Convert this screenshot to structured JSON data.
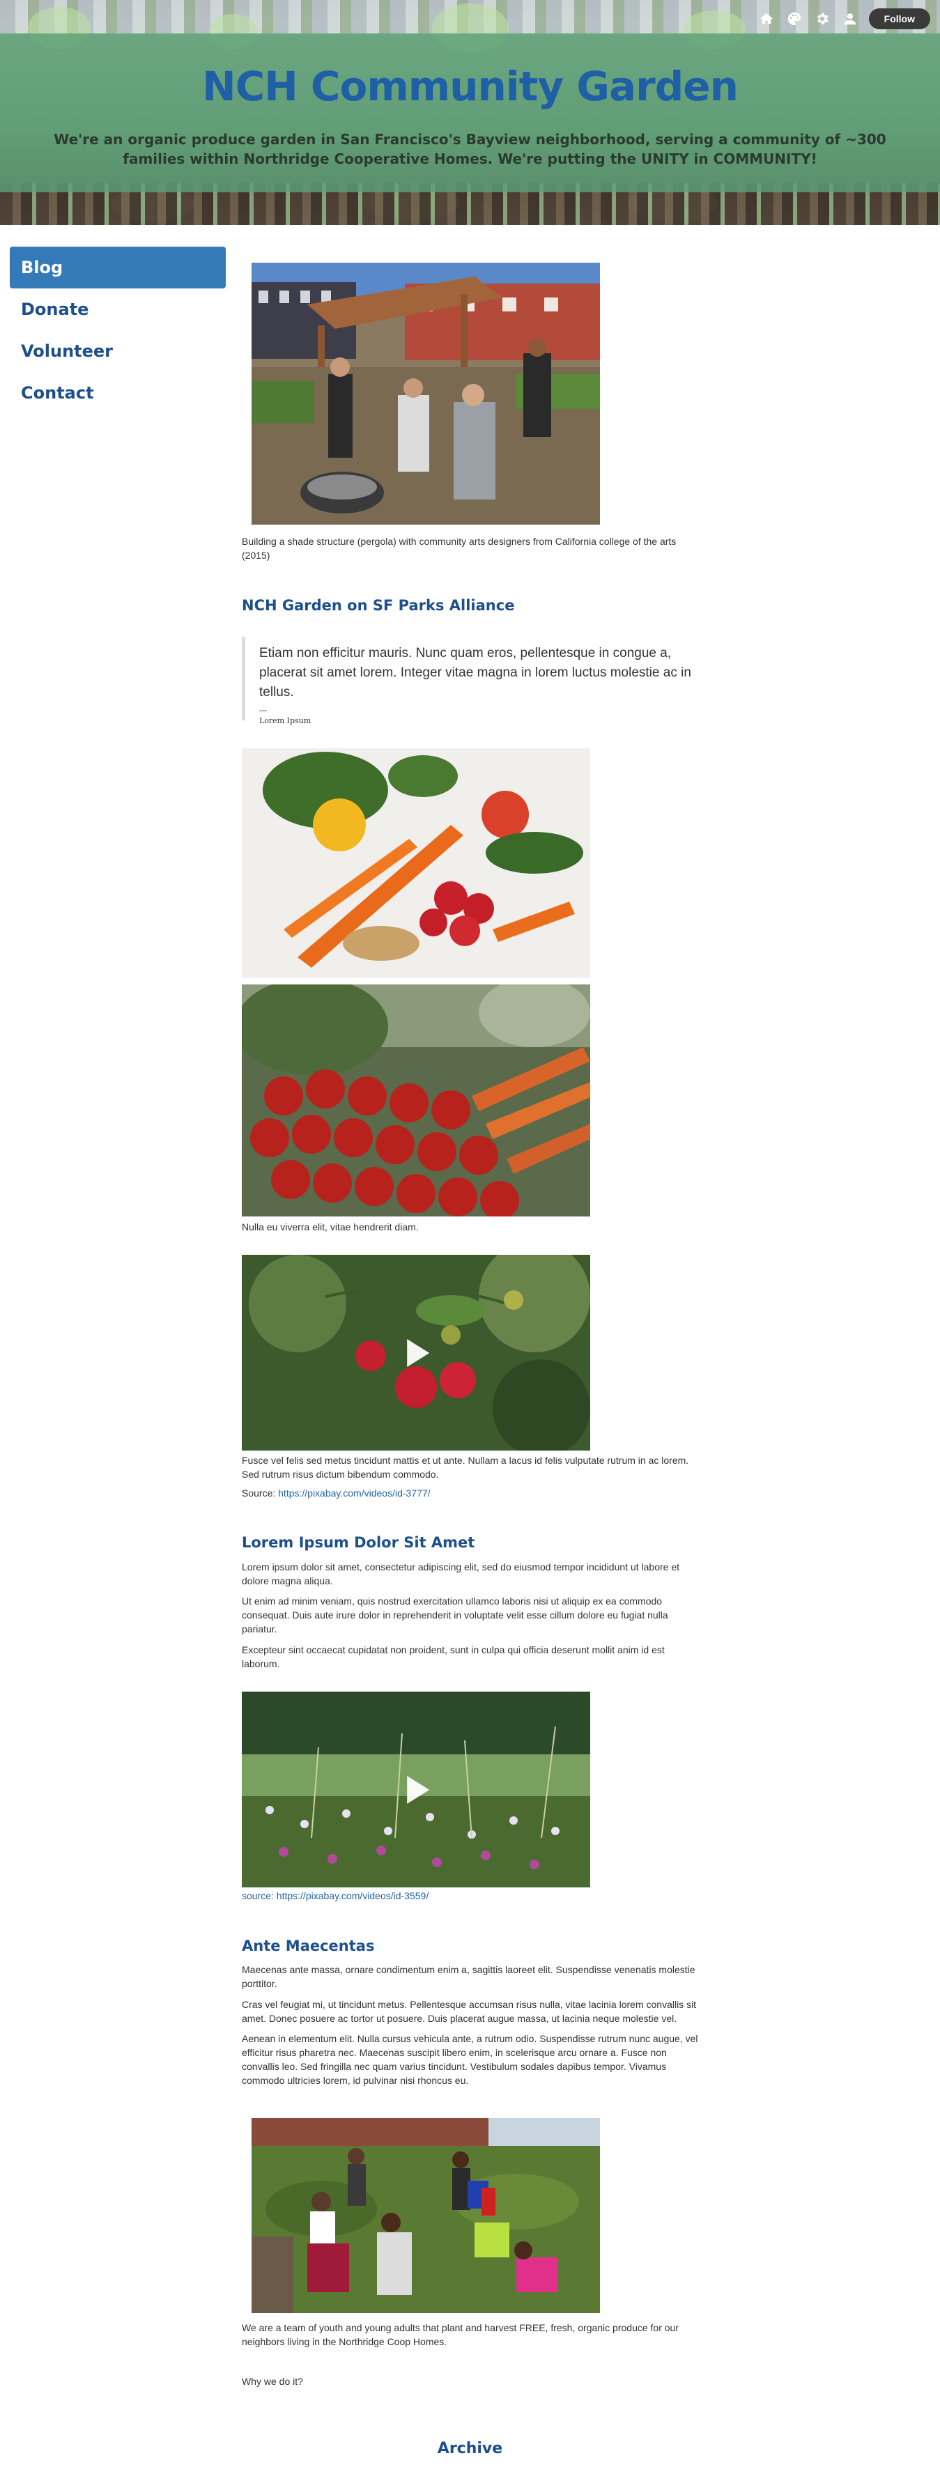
{
  "site": {
    "title": "NCH Community Garden",
    "description": "We're an organic produce garden in San Francisco's Bayview neighborhood, serving a community of ~300 families within Northridge Cooperative Homes. We're putting the UNITY in COMMUNITY!"
  },
  "topbar": {
    "icons": [
      "home-icon",
      "palette-icon",
      "gear-icon",
      "person-icon"
    ],
    "follow_label": "Follow"
  },
  "nav": {
    "items": [
      {
        "label": "Blog",
        "active": true
      },
      {
        "label": "Donate",
        "active": false
      },
      {
        "label": "Volunteer",
        "active": false
      },
      {
        "label": "Contact",
        "active": false
      }
    ]
  },
  "posts": {
    "p1": {
      "caption": "Building a shade structure (pergola) with community arts designers from California college of the arts (2015)"
    },
    "p2": {
      "title": "NCH Garden on SF Parks Alliance",
      "quote": "Etiam non efficitur mauris. Nunc quam eros, pellentesque in congue a, placerat sit amet lorem. Integer vitae magna in lorem luctus molestie ac in tellus.",
      "quote_dash": "—",
      "quote_cite": "Lorem Ipsum"
    },
    "p3": {
      "caption": "Nulla eu viverra elit, vitae hendrerit diam."
    },
    "p4": {
      "text": "Fusce vel felis sed metus tincidunt mattis et ut ante. Nullam a lacus id felis vulputate rutrum in ac lorem. Sed rutrum risus dictum bibendum commodo.",
      "source_prefix": "Source: ",
      "source_link": "https://pixabay.com/videos/id-3777/"
    },
    "p5": {
      "title": "Lorem Ipsum Dolor Sit Amet",
      "paragraphs": [
        "Lorem ipsum dolor sit amet, consectetur adipiscing elit, sed do eiusmod tempor incididunt ut labore et dolore magna aliqua.",
        "Ut enim ad minim veniam, quis nostrud exercitation ullamco laboris nisi ut aliquip ex ea commodo consequat. Duis aute irure dolor in reprehenderit in voluptate velit esse cillum dolore eu fugiat nulla pariatur.",
        "Excepteur sint occaecat cupidatat non proident, sunt in culpa qui officia deserunt mollit anim id est laborum."
      ]
    },
    "p6": {
      "source_link": "source: https://pixabay.com/videos/id-3559/"
    },
    "p7": {
      "title": "Ante Maecentas",
      "paragraphs": [
        "Maecenas ante massa, ornare condimentum enim a, sagittis laoreet elit. Suspendisse venenatis molestie porttitor.",
        "Cras vel feugiat mi, ut tincidunt metus. Pellentesque accumsan risus nulla, vitae lacinia lorem convallis sit amet. Donec posuere ac tortor ut posuere. Duis placerat augue massa, ut lacinia neque molestie vel.",
        "Aenean in elementum elit. Nulla cursus vehicula ante, a rutrum odio. Suspendisse rutrum nunc augue, vel efficitur risus pharetra nec. Maecenas suscipit libero enim, in scelerisque arcu ornare a. Fusce non convallis leo. Sed fringilla nec quam varius tincidunt. Vestibulum sodales dapibus tempor. Vivamus commodo ultricies lorem, id pulvinar nisi rhoncus eu."
      ]
    },
    "p8": {
      "caption": " We are a team of youth and young adults that plant and harvest FREE, fresh, organic produce for our neighbors living in the Northridge Coop Homes.",
      "why": "Why we do it?"
    }
  },
  "archive": {
    "title": "Archive"
  }
}
